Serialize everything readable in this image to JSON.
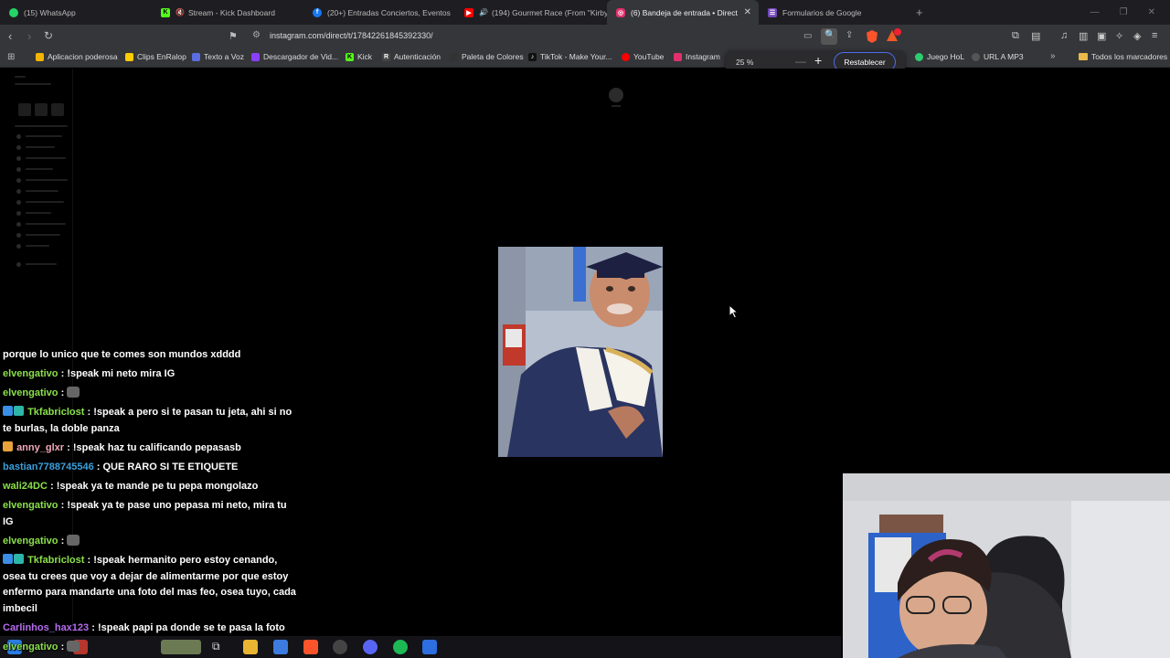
{
  "tabs": [
    {
      "title": "(15) WhatsApp",
      "icon": "whatsapp-icon",
      "color": "#25d366"
    },
    {
      "title": "Stream - Kick Dashboard",
      "icon": "kick-icon",
      "color": "#53fc18"
    },
    {
      "title": "(20+) Entradas Conciertos, Eventos",
      "icon": "facebook-icon",
      "color": "#1877f2"
    },
    {
      "title": "(194) Gourmet Race (From \"Kirby",
      "icon": "youtube-icon",
      "color": "#ff0000"
    },
    {
      "title": "(6) Bandeja de entrada • Direct",
      "icon": "instagram-icon",
      "color": "#e1306c",
      "active": true
    },
    {
      "title": "Formularios de Google",
      "icon": "google-forms-icon",
      "color": "#7248b9"
    }
  ],
  "address": {
    "url": "instagram.com/direct/t/17842261845392330/"
  },
  "bookmarks": [
    {
      "label": "Aplicacion poderosa",
      "color": "#f4b400"
    },
    {
      "label": "Clips EnRalop",
      "color": "#ffcc00"
    },
    {
      "label": "Texto a Voz",
      "color": "#5b6ee1"
    },
    {
      "label": "Descargador de Vid...",
      "color": "#8a3ffc"
    },
    {
      "label": "Kick",
      "color": "#53fc18"
    },
    {
      "label": "Autenticación",
      "color": "#444444"
    },
    {
      "label": "Paleta de Colores",
      "color": "#333333"
    },
    {
      "label": "TikTok - Make Your...",
      "color": "#111111"
    },
    {
      "label": "YouTube",
      "color": "#ff0000"
    },
    {
      "label": "Instagram",
      "color": "#e1306c"
    },
    {
      "label": "Juego HoL",
      "color": "#2ecc71"
    },
    {
      "label": "URL A MP3",
      "color": "#555555"
    }
  ],
  "bookmarks_folder": "Todos los marcadores",
  "zoom": {
    "value": "25 %",
    "reset_label": "Restablecer"
  },
  "chat": [
    {
      "user": "",
      "text": "porque lo unico que te comes son mundos xdddd"
    },
    {
      "user": "elvengativo",
      "text": "!speak mi neto mira IG",
      "color": "green"
    },
    {
      "user": "elvengativo",
      "text": "",
      "color": "green",
      "emote": true
    },
    {
      "user": "Tkfabriclost",
      "text": "!speak a pero si te pasan tu jeta, ahi si no te burlas, la doble panza",
      "color": "green",
      "badges": 2
    },
    {
      "user": "anny_glxr",
      "text": "!speak haz tu calificando pepasasb",
      "color": "pink",
      "badges": 1
    },
    {
      "user": "bastian7788745546",
      "text": "QUE RARO SI TE ETIQUETE",
      "color": "blue"
    },
    {
      "user": "wali24DC",
      "text": "!speak ya te mande pe tu pepa mongolazo",
      "color": "green"
    },
    {
      "user": "elvengativo",
      "text": "!speak ya te pase uno pepasa mi neto, mira tu IG",
      "color": "green"
    },
    {
      "user": "elvengativo",
      "text": "",
      "color": "green",
      "emote": true
    },
    {
      "user": "Tkfabriclost",
      "text": "!speak hermanito pero estoy cenando, osea tu crees que voy a dejar de alimentarme por que estoy enfermo para mandarte una foto del mas feo, osea tuyo, cada imbecil",
      "color": "green",
      "badges": 2
    },
    {
      "user": "Carlinhos_hax123",
      "text": "!speak papi pa donde se te pasa la foto",
      "color": "purple"
    },
    {
      "user": "elvengativo",
      "text": "",
      "color": "green",
      "emote": true
    }
  ]
}
